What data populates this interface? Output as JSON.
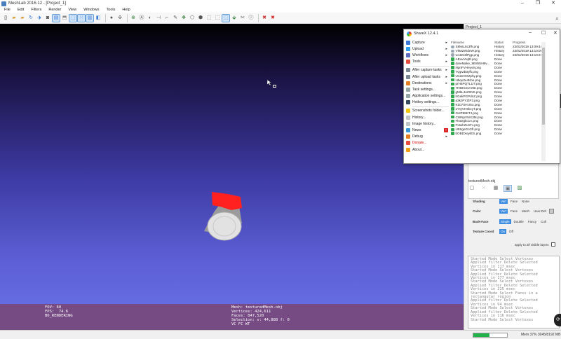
{
  "window": {
    "title": "MeshLab 2016.12 - [Project_1]",
    "controls": [
      "–",
      "❐",
      "✕"
    ]
  },
  "menubar": [
    "File",
    "Edit",
    "Filters",
    "Render",
    "View",
    "Windows",
    "Tools",
    "Help"
  ],
  "viewport": {
    "hud_left": "FOV: 60\nFPS:  74.6\nBO_RENDERING",
    "hud_right": "Mesh: texturedMesh.obj\nVertices: 424,611\nFaces: 847,520\nSelection: v: 44,888 f: 0\nVC FC WT"
  },
  "panel": {
    "title": "Project_1",
    "mesh_name": "texturedMesh.obj",
    "shading": {
      "label": "Shading",
      "options": [
        "Vert",
        "Face",
        "None"
      ],
      "selected": "Vert"
    },
    "color": {
      "label": "Color",
      "options": [
        "Vert",
        "Face",
        "Mesh",
        "User-Def"
      ],
      "selected": "Vert"
    },
    "backface": {
      "label": "Back-Face",
      "options": [
        "Single",
        "Double",
        "Fancy",
        "Cull"
      ],
      "selected": "Single"
    },
    "texture": {
      "label": "Texture Coord",
      "options": [
        "On",
        "Off"
      ],
      "selected": "On"
    },
    "apply_all": "apply to all visible layers",
    "log": [
      "Started Mode Select Vertexes",
      "Applied filter Delete Selected",
      "Vertices in 117 msec",
      "Started Mode Select Vertexes",
      "Applied filter Delete Selected",
      "Vertices in 177 msec",
      "Started Mode Select Vertexes",
      "Applied filter Delete Selected",
      "Vertices in 225 msec",
      "Started Mode Select Faces in a",
      "rectangular region",
      "Applied filter Delete Selected",
      "Vertices in 94 msec",
      "Started Mode Select Vertexes",
      "Applied filter Delete Selected",
      "Vertices in 116 msec",
      "Started Mode Select Vertexes"
    ]
  },
  "statusbar": {
    "memory": "Mem 37% 3045/8192 MB",
    "progress": 0.48
  },
  "sharex": {
    "title": "ShareX 12.4.1",
    "menu": [
      {
        "label": "Capture",
        "icon": "#3c78d8",
        "arrow": true
      },
      {
        "label": "Upload",
        "icon": "#2a9df4",
        "arrow": true
      },
      {
        "label": "Workflows",
        "icon": "#5c6bc0",
        "arrow": true
      },
      {
        "label": "Tools",
        "icon": "#e74c3c",
        "arrow": true
      },
      {
        "sep": true
      },
      {
        "label": "After capture tasks",
        "icon": "#7b8894",
        "arrow": true
      },
      {
        "label": "After upload tasks",
        "icon": "#7b8894",
        "arrow": true
      },
      {
        "label": "Destinations",
        "icon": "#e67e22",
        "arrow": true
      },
      {
        "label": "Task settings...",
        "icon": "#95a5a6"
      },
      {
        "label": "Application settings...",
        "icon": "#95a5a6"
      },
      {
        "label": "Hotkey settings...",
        "icon": "#34495e"
      },
      {
        "sep": true
      },
      {
        "label": "Screenshots folder...",
        "icon": "#f1c40f"
      },
      {
        "label": "History...",
        "icon": "#bdc3c7"
      },
      {
        "label": "Image history...",
        "icon": "#bdc3c7"
      },
      {
        "label": "News",
        "icon": "#3498db",
        "badge": "!"
      },
      {
        "label": "Debug",
        "icon": "#e67e22",
        "arrow": true
      },
      {
        "label": "Donate...",
        "icon": "#e74c3c",
        "red": true
      },
      {
        "label": "About...",
        "icon": "#f39c12"
      }
    ],
    "columns": [
      "Filename",
      "Status",
      "Progress"
    ],
    "rows": [
      {
        "name": "SkNsL5c3fh.png",
        "status": "History",
        "progress": "23/02/2019 13:09:44",
        "type": "hist"
      },
      {
        "name": "VkMZekdeW.png",
        "status": "History",
        "progress": "23/02/2019 13:10:06",
        "type": "hist"
      },
      {
        "name": "wAtZe6lPgp.png",
        "status": "History",
        "progress": "23/02/2019 13:10:27",
        "type": "hist"
      },
      {
        "name": "AEuvVwj9f.png",
        "status": "Done",
        "progress": "",
        "type": "done"
      },
      {
        "name": "dareMake_5E8hNH6v...",
        "status": "Done",
        "progress": "",
        "type": "done"
      },
      {
        "name": "NpnFVHeyv9.png",
        "status": "Done",
        "progress": "",
        "type": "done"
      },
      {
        "name": "TQpvdt3yfk.png",
        "status": "Done",
        "progress": "",
        "type": "done"
      },
      {
        "name": "Un2eOGZphy.png",
        "status": "Done",
        "progress": "",
        "type": "done"
      },
      {
        "name": "Hbqu2e4Kbe.png",
        "status": "Done",
        "progress": "",
        "type": "done"
      },
      {
        "name": "prH5PQTL1rT.png",
        "status": "Done",
        "progress": "",
        "type": "done"
      },
      {
        "name": "7HBECIoAX6t.png",
        "status": "Done",
        "progress": "",
        "type": "done"
      },
      {
        "name": "gMkL4uZ2NS.png",
        "status": "Done",
        "progress": "",
        "type": "done"
      },
      {
        "name": "hGekPGPdnZ.png",
        "status": "Done",
        "progress": "",
        "type": "done"
      },
      {
        "name": "a3kzPYZIP3.png",
        "status": "Done",
        "progress": "",
        "type": "done"
      },
      {
        "name": "Kdo7SHUSu.png",
        "status": "Done",
        "progress": "",
        "type": "done"
      },
      {
        "name": "oYQVHSkcyT.png",
        "status": "Done",
        "progress": "",
        "type": "done"
      },
      {
        "name": "GxtP58KTJ.png",
        "status": "Done",
        "progress": "",
        "type": "done"
      },
      {
        "name": "CWNpV5rX3M.png",
        "status": "Done",
        "progress": "",
        "type": "done"
      },
      {
        "name": "FkoDgkc1A.png",
        "status": "Done",
        "progress": "",
        "type": "done"
      },
      {
        "name": "FxtwhZUvFv.png",
        "status": "Done",
        "progress": "",
        "type": "done"
      },
      {
        "name": "U5SgeGcGfl.png",
        "status": "Done",
        "progress": "",
        "type": "done"
      },
      {
        "name": "bOBDXeyIES.png",
        "status": "Done",
        "progress": "",
        "type": "done"
      }
    ]
  },
  "colors": {
    "accent": "#3c8de0",
    "viewport_band": "#764a82",
    "progress_fill": "#22b24c"
  }
}
